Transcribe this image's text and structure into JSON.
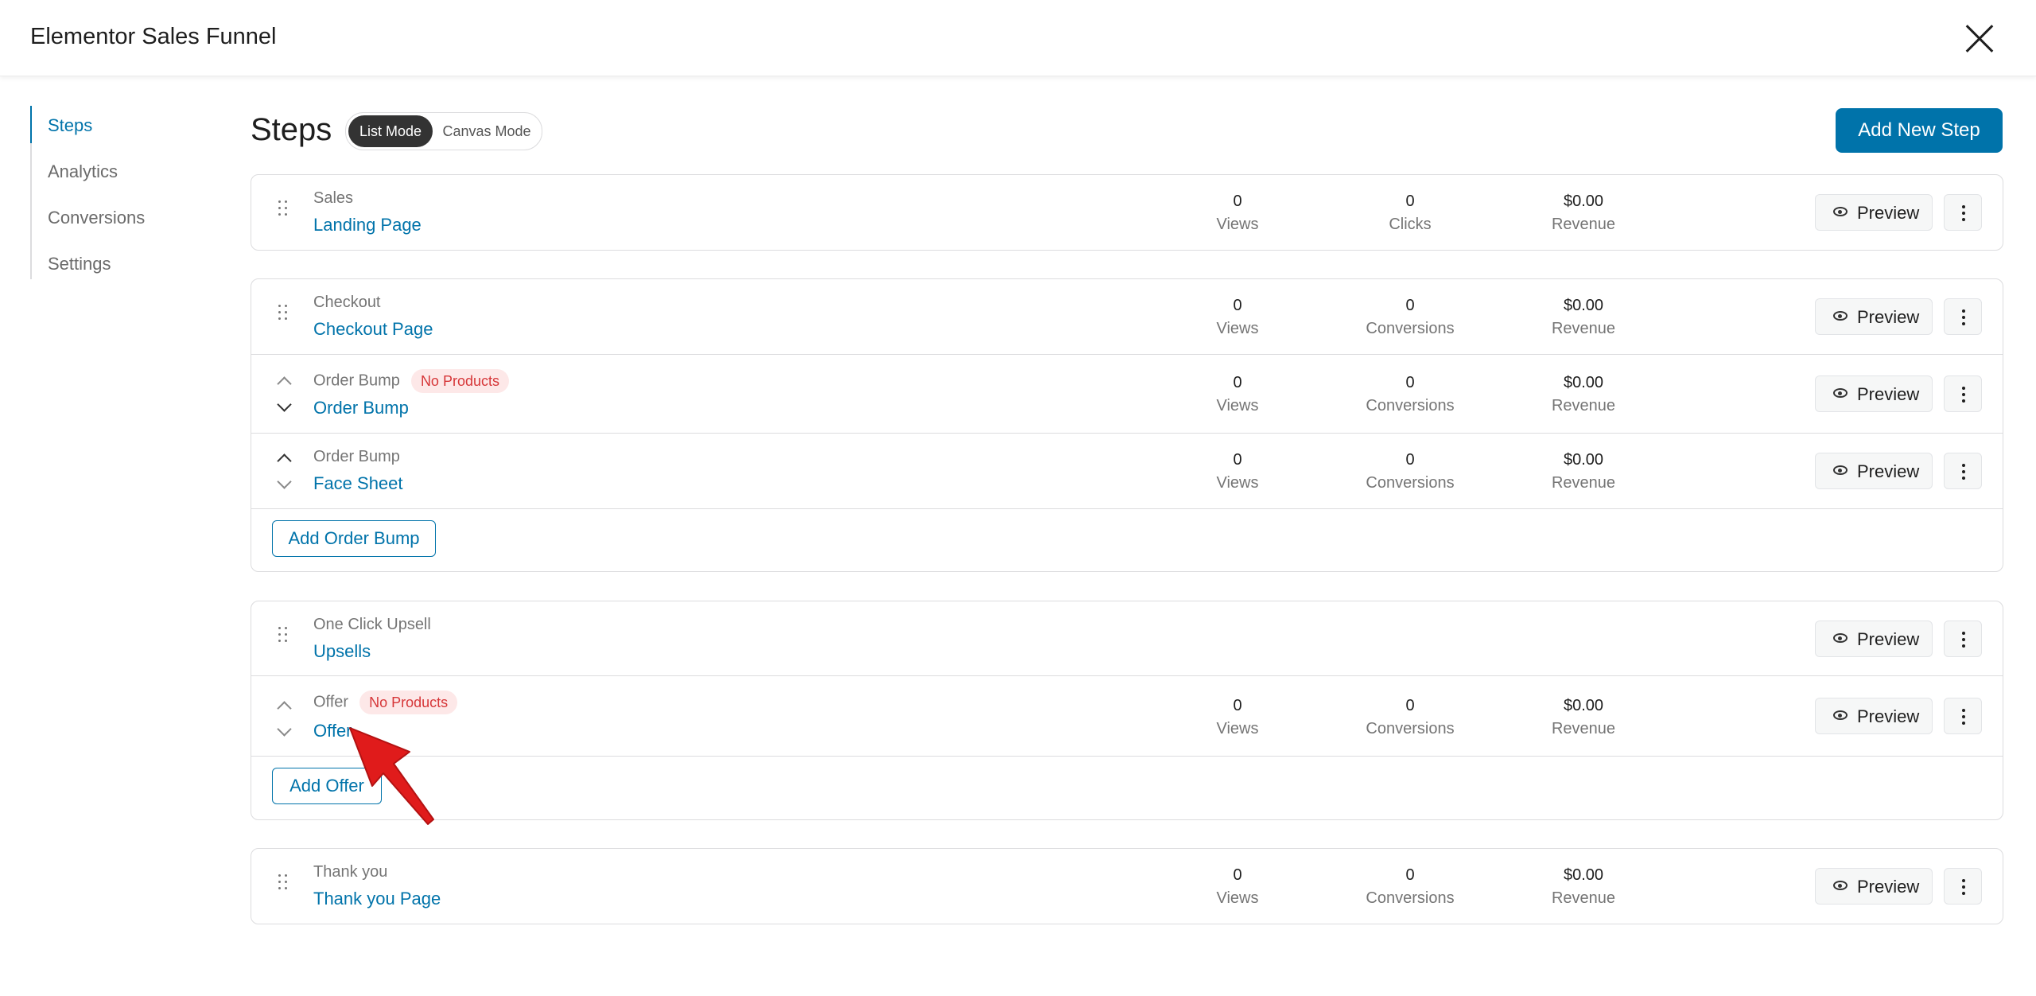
{
  "header": {
    "title": "Elementor Sales Funnel"
  },
  "sidebar": {
    "items": [
      {
        "label": "Steps"
      },
      {
        "label": "Analytics"
      },
      {
        "label": "Conversions"
      },
      {
        "label": "Settings"
      }
    ]
  },
  "main": {
    "title": "Steps",
    "modes": {
      "list": "List Mode",
      "canvas": "Canvas Mode"
    },
    "add_step_label": "Add New Step",
    "preview_label": "Preview",
    "badge_no_products": "No Products",
    "add_order_bump_label": "Add Order Bump",
    "add_offer_label": "Add Offer"
  },
  "steps": {
    "sales": {
      "type": "Sales",
      "name": "Landing Page",
      "stats": [
        {
          "value": "0",
          "label": "Views"
        },
        {
          "value": "0",
          "label": "Clicks"
        },
        {
          "value": "$0.00",
          "label": "Revenue"
        }
      ]
    },
    "checkout": {
      "type": "Checkout",
      "name": "Checkout Page",
      "stats": [
        {
          "value": "0",
          "label": "Views"
        },
        {
          "value": "0",
          "label": "Conversions"
        },
        {
          "value": "$0.00",
          "label": "Revenue"
        }
      ]
    },
    "bump1": {
      "type": "Order Bump",
      "name": "Order Bump",
      "stats": [
        {
          "value": "0",
          "label": "Views"
        },
        {
          "value": "0",
          "label": "Conversions"
        },
        {
          "value": "$0.00",
          "label": "Revenue"
        }
      ]
    },
    "bump2": {
      "type": "Order Bump",
      "name": "Face Sheet",
      "stats": [
        {
          "value": "0",
          "label": "Views"
        },
        {
          "value": "0",
          "label": "Conversions"
        },
        {
          "value": "$0.00",
          "label": "Revenue"
        }
      ]
    },
    "upsell": {
      "type": "One Click Upsell",
      "name": "Upsells"
    },
    "offer": {
      "type": "Offer",
      "name": "Offer",
      "stats": [
        {
          "value": "0",
          "label": "Views"
        },
        {
          "value": "0",
          "label": "Conversions"
        },
        {
          "value": "$0.00",
          "label": "Revenue"
        }
      ]
    },
    "thankyou": {
      "type": "Thank you",
      "name": "Thank you Page",
      "stats": [
        {
          "value": "0",
          "label": "Views"
        },
        {
          "value": "0",
          "label": "Conversions"
        },
        {
          "value": "$0.00",
          "label": "Revenue"
        }
      ]
    }
  }
}
